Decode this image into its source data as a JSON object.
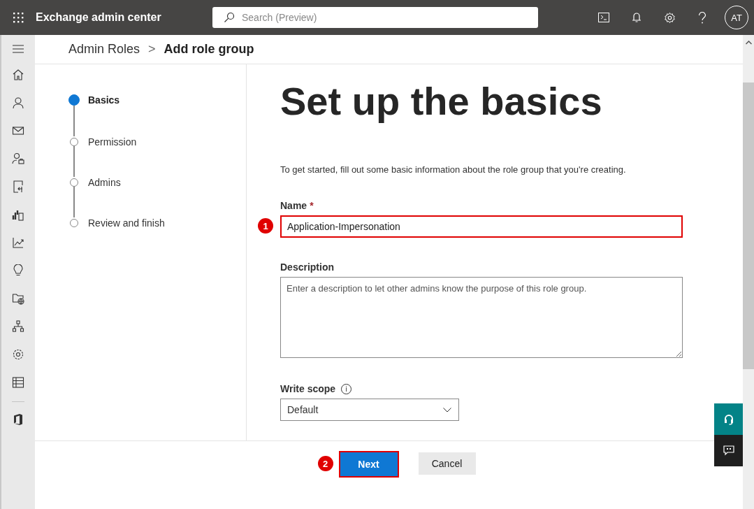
{
  "app_bar": {
    "title": "Exchange admin center",
    "search": {
      "placeholder": "Search (Preview)"
    },
    "avatar": "AT"
  },
  "breadcrumb": {
    "parent": "Admin Roles",
    "separator": ">",
    "current": "Add role group"
  },
  "steps": [
    {
      "label": "Basics",
      "selected": true
    },
    {
      "label": "Permission",
      "selected": false
    },
    {
      "label": "Admins",
      "selected": false
    },
    {
      "label": "Review and finish",
      "selected": false
    }
  ],
  "heading": "Set up the basics",
  "intro": "To get started, fill out some basic information about the role group that you're creating.",
  "name_field": {
    "label": "Name",
    "required_mark": "*",
    "value": "Application-Impersonation",
    "highlighted": true,
    "callout": "1"
  },
  "description_field": {
    "label": "Description",
    "placeholder": "Enter a description to let other admins know the purpose of this role group."
  },
  "write_scope": {
    "label": "Write scope",
    "info": "i",
    "value": "Default"
  },
  "footer": {
    "next": {
      "label": "Next",
      "highlighted": true,
      "callout": "2"
    },
    "cancel": "Cancel"
  }
}
